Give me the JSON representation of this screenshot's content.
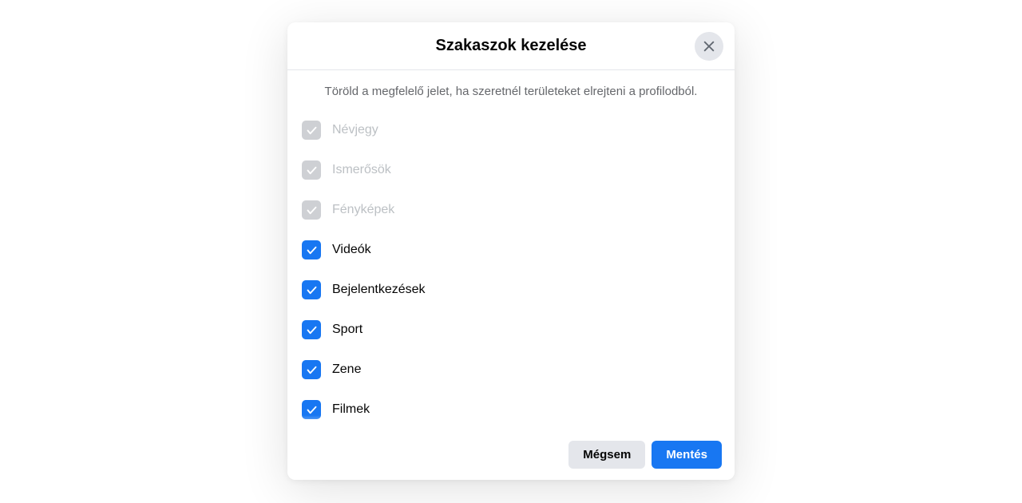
{
  "dialog": {
    "title": "Szakaszok kezelése",
    "description": "Töröld a megfelelő jelet, ha szeretnél területeket elrejteni a profilodból.",
    "sections": [
      {
        "label": "Névjegy",
        "checked": true,
        "locked": true
      },
      {
        "label": "Ismerősök",
        "checked": true,
        "locked": true
      },
      {
        "label": "Fényképek",
        "checked": true,
        "locked": true
      },
      {
        "label": "Videók",
        "checked": true,
        "locked": false
      },
      {
        "label": "Bejelentkezések",
        "checked": true,
        "locked": false
      },
      {
        "label": "Sport",
        "checked": true,
        "locked": false
      },
      {
        "label": "Zene",
        "checked": true,
        "locked": false
      },
      {
        "label": "Filmek",
        "checked": true,
        "locked": false
      }
    ],
    "buttons": {
      "cancel": "Mégsem",
      "save": "Mentés"
    }
  }
}
